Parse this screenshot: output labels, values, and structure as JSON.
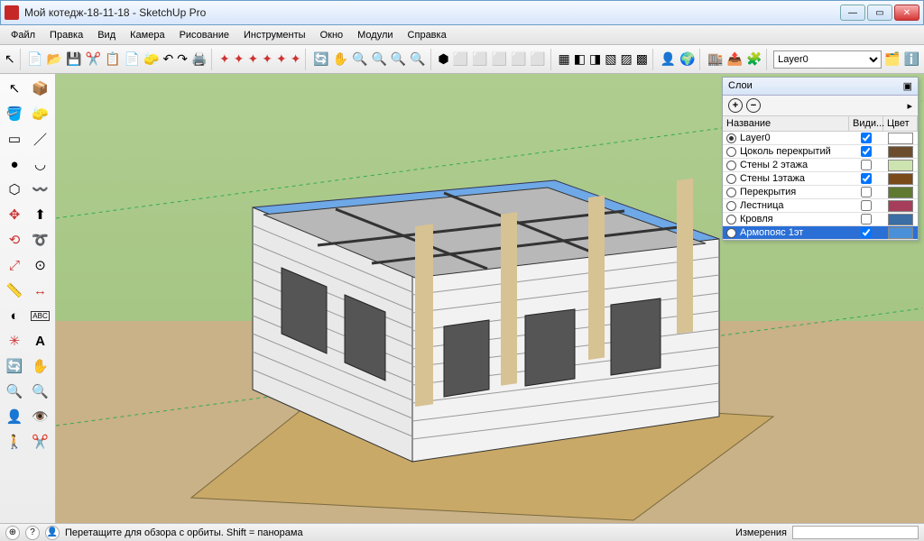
{
  "window": {
    "title": "Мой котедж-18-11-18 - SketchUp Pro"
  },
  "menu": [
    "Файл",
    "Правка",
    "Вид",
    "Камера",
    "Рисование",
    "Инструменты",
    "Окно",
    "Модули",
    "Справка"
  ],
  "toolbar_layer_selected": "Layer0",
  "layers_panel": {
    "title": "Слои",
    "col_name": "Название",
    "col_vis": "Види...",
    "col_color": "Цвет",
    "rows": [
      {
        "label": "Layer0",
        "active": true,
        "visible": true,
        "color": "#ffffff",
        "selected": false
      },
      {
        "label": "Цоколь перекрытий",
        "active": false,
        "visible": true,
        "color": "#6b4d2e",
        "selected": false
      },
      {
        "label": "Стены 2 этажа",
        "active": false,
        "visible": false,
        "color": "#cde3b0",
        "selected": false
      },
      {
        "label": "Стены 1этажа",
        "active": false,
        "visible": true,
        "color": "#7a4a1a",
        "selected": false
      },
      {
        "label": "Перекрытия",
        "active": false,
        "visible": false,
        "color": "#5f7930",
        "selected": false
      },
      {
        "label": "Лестница",
        "active": false,
        "visible": false,
        "color": "#a63d5a",
        "selected": false
      },
      {
        "label": "Кровля",
        "active": false,
        "visible": false,
        "color": "#3a6ea5",
        "selected": false
      },
      {
        "label": "Армопояс 1эт",
        "active": false,
        "visible": true,
        "color": "#4a90d9",
        "selected": true
      }
    ]
  },
  "status": {
    "hint": "Перетащите для обзора с орбиты.  Shift = панорама",
    "meas_label": "Измерения"
  }
}
